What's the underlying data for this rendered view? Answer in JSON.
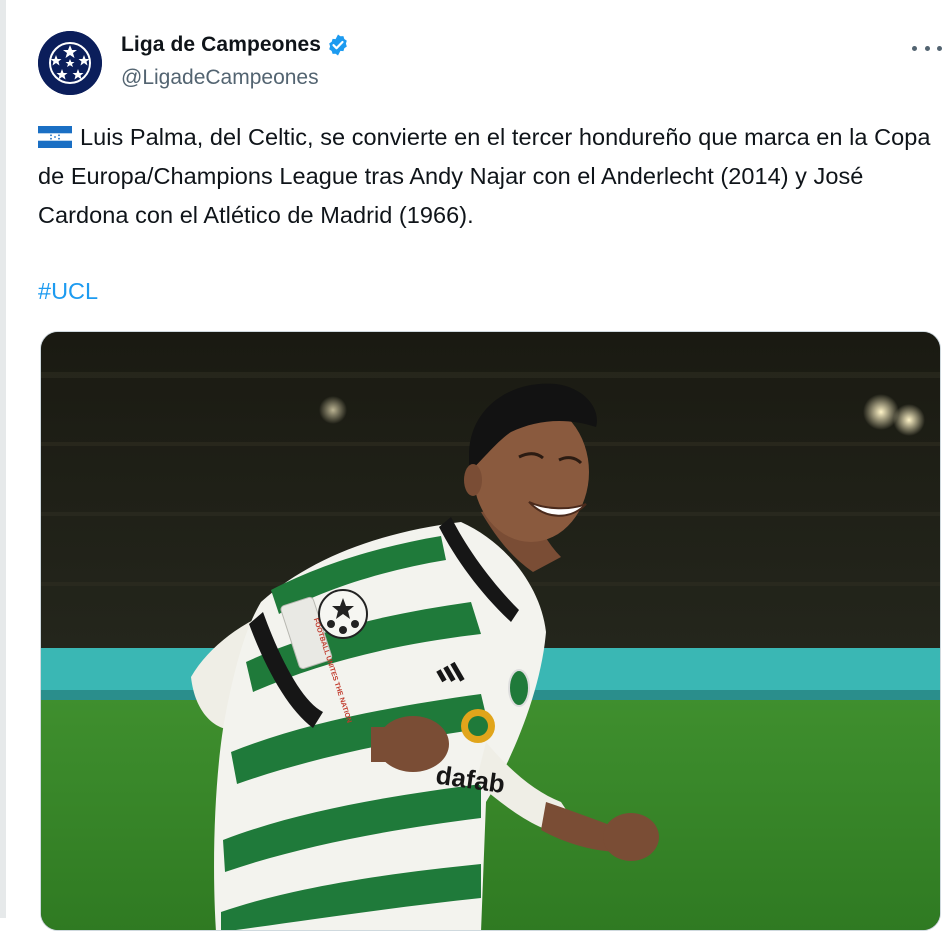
{
  "account": {
    "display_name": "Liga de Campeones",
    "handle": "@LigadeCampeones",
    "verified": true,
    "avatar_icon": "champions-league-starball-icon"
  },
  "tweet": {
    "text": "Luis Palma, del Celtic, se convierte en el tercer hondureño que marca en la Copa de Europa/Champions League tras Andy Najar con el Anderlecht (2014) y José Cardona con el Atlético de Madrid (1966).",
    "flag_icon": "honduras-flag-icon",
    "hashtag": "#UCL"
  },
  "media": {
    "sleeve_patch": "FOOTBALL UNITES THE NATION",
    "shirt_sponsor": "dafab",
    "kit_brand_icon": "adidas-three-stripes-icon"
  },
  "colors": {
    "primary_text": "#0f1419",
    "secondary_text": "#536471",
    "link": "#1d9bf0",
    "verified_badge": "#1d9bf0",
    "avatar_bg": "#0b1e5b",
    "celtic_green": "#1f7a3a"
  }
}
